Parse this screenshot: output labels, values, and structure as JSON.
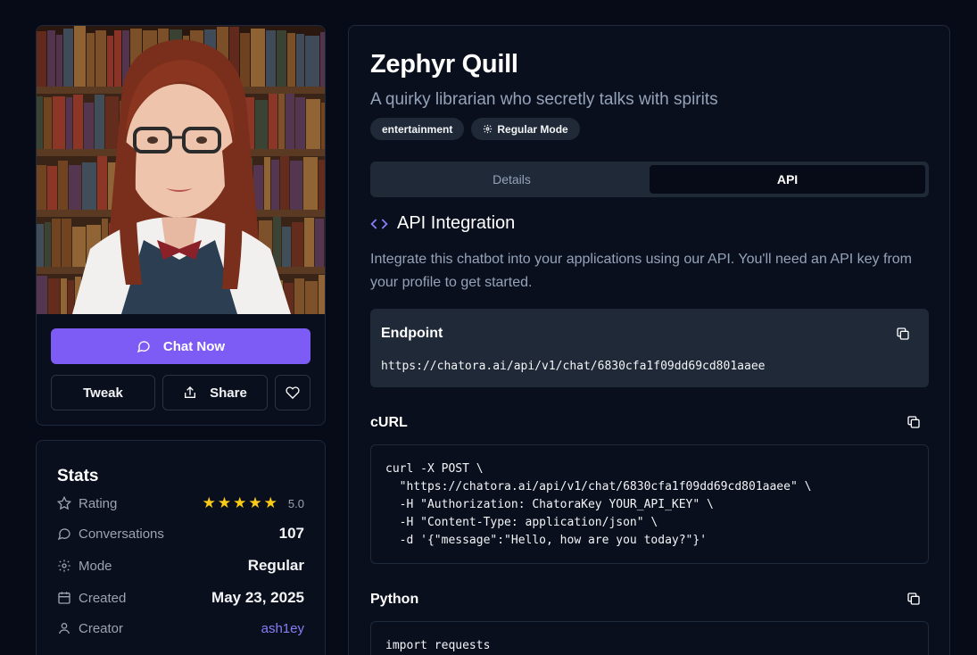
{
  "profile": {
    "chat_label": "Chat Now",
    "tweak_label": "Tweak",
    "share_label": "Share"
  },
  "stats": {
    "title": "Stats",
    "rating_label": "Rating",
    "rating_value": "5.0",
    "rating_stars": 5,
    "conversations_label": "Conversations",
    "conversations_value": "107",
    "mode_label": "Mode",
    "mode_value": "Regular",
    "created_label": "Created",
    "created_value": "May 23, 2025",
    "creator_label": "Creator",
    "creator_value": "ash1ey"
  },
  "header": {
    "title": "Zephyr Quill",
    "subtitle": "A quirky librarian who secretly talks with spirits",
    "badges": [
      "entertainment",
      "Regular Mode"
    ]
  },
  "tabs": [
    {
      "label": "Details",
      "active": false
    },
    {
      "label": "API",
      "active": true
    }
  ],
  "api": {
    "heading": "API Integration",
    "intro": "Integrate this chatbot into your applications using our API. You'll need an API key from your profile to get started.",
    "endpoint_label": "Endpoint",
    "endpoint_url": "https://chatora.ai/api/v1/chat/6830cfa1f09dd69cd801aaee",
    "curl_label": "cURL",
    "curl_lines": [
      "curl -X POST \\",
      "  \"https://chatora.ai/api/v1/chat/6830cfa1f09dd69cd801aaee\" \\",
      "  -H \"Authorization: ChatoraKey YOUR_API_KEY\" \\",
      "  -H \"Content-Type: application/json\" \\",
      "  -d '{\"message\":\"Hello, how are you today?\"}'"
    ],
    "python_label": "Python",
    "python_lines": [
      "import requests"
    ]
  },
  "colors": {
    "accent": "#7c5cf5",
    "background": "#070b17",
    "star": "#facc15"
  }
}
